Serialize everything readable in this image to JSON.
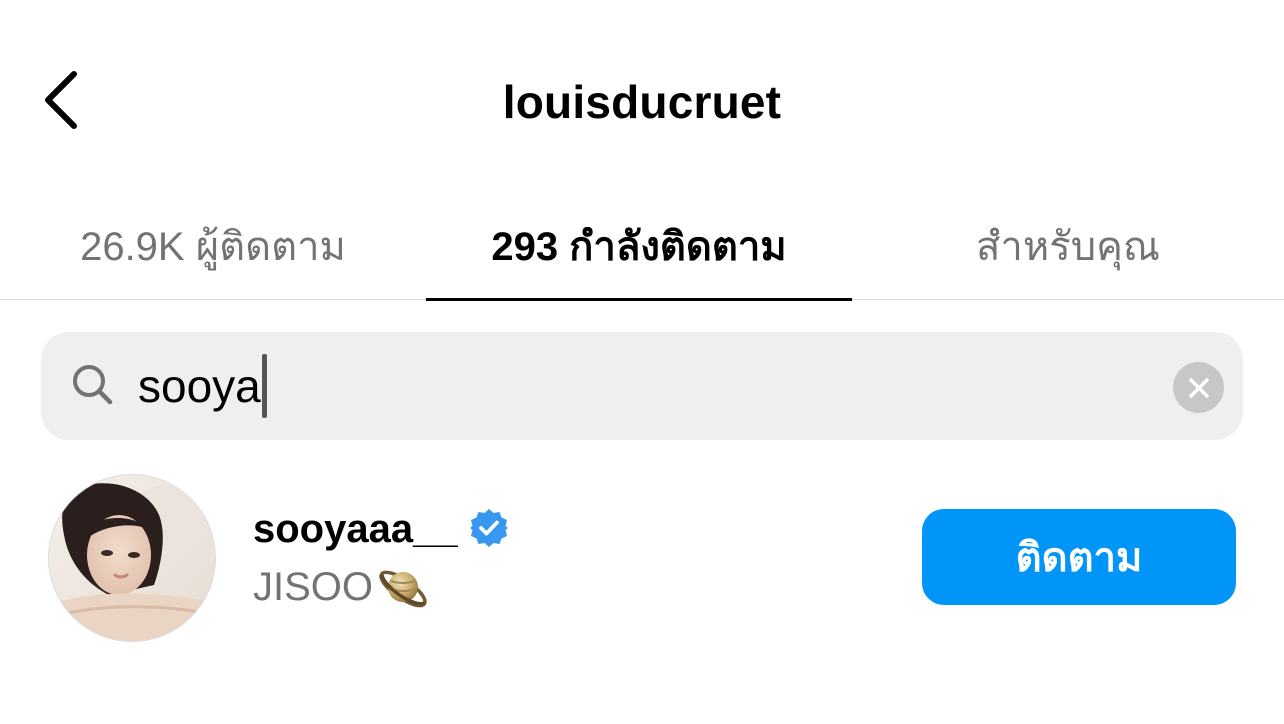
{
  "header": {
    "title": "louisducruet",
    "back_icon": "chevron-left-icon"
  },
  "tabs": [
    {
      "label": "26.9K ผู้ติดตาม",
      "selected": false
    },
    {
      "label": "293 กำลังติดตาม",
      "selected": true
    },
    {
      "label": "สำหรับคุณ",
      "selected": false
    }
  ],
  "search": {
    "value": "sooya",
    "icon": "search-icon",
    "clear_icon": "close-icon"
  },
  "results": [
    {
      "username": "sooyaaa__",
      "verified": true,
      "full_name": "JISOO",
      "name_emoji": "ringed-planet-icon",
      "follow_label": "ติดตาม"
    }
  ],
  "colors": {
    "accent": "#0095f6",
    "verified": "#3897f0",
    "secondary_text": "#737373",
    "search_bg": "#efefef"
  }
}
